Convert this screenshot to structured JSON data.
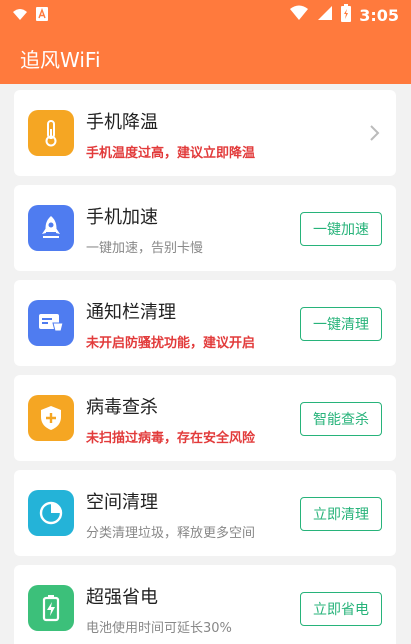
{
  "status_bar": {
    "time": "3:05",
    "icons": [
      "wifi-icon",
      "app-notification-icon",
      "signal-icon",
      "battery-icon"
    ]
  },
  "app": {
    "title": "追风WiFi",
    "header_color": "#ff7a3d"
  },
  "cards": [
    {
      "title": "手机降温",
      "subtitle": "手机温度过高，建议立即降温",
      "subtitle_warn": true,
      "icon": "thermometer-icon",
      "icon_color": "#f5a623",
      "action": null
    },
    {
      "title": "手机加速",
      "subtitle": "一键加速，告别卡慢",
      "subtitle_warn": false,
      "icon": "rocket-icon",
      "icon_color": "#4f7cf0",
      "action": "一键加速"
    },
    {
      "title": "通知栏清理",
      "subtitle": "未开启防骚扰功能，建议开启",
      "subtitle_warn": true,
      "icon": "notification-clean-icon",
      "icon_color": "#4f7cf0",
      "action": "一键清理"
    },
    {
      "title": "病毒查杀",
      "subtitle": "未扫描过病毒，存在安全风险",
      "subtitle_warn": true,
      "icon": "shield-icon",
      "icon_color": "#f5a623",
      "action": "智能查杀"
    },
    {
      "title": "空间清理",
      "subtitle": "分类清理垃圾，释放更多空间",
      "subtitle_warn": false,
      "icon": "pie-chart-icon",
      "icon_color": "#24b3d8",
      "action": "立即清理"
    },
    {
      "title": "超强省电",
      "subtitle": "电池使用时间可延长30%",
      "subtitle_warn": false,
      "icon": "battery-save-icon",
      "icon_color": "#3cc07a",
      "action": "立即省电"
    }
  ],
  "colors": {
    "accent_green": "#27b37a",
    "warn_red": "#e23b3b"
  }
}
